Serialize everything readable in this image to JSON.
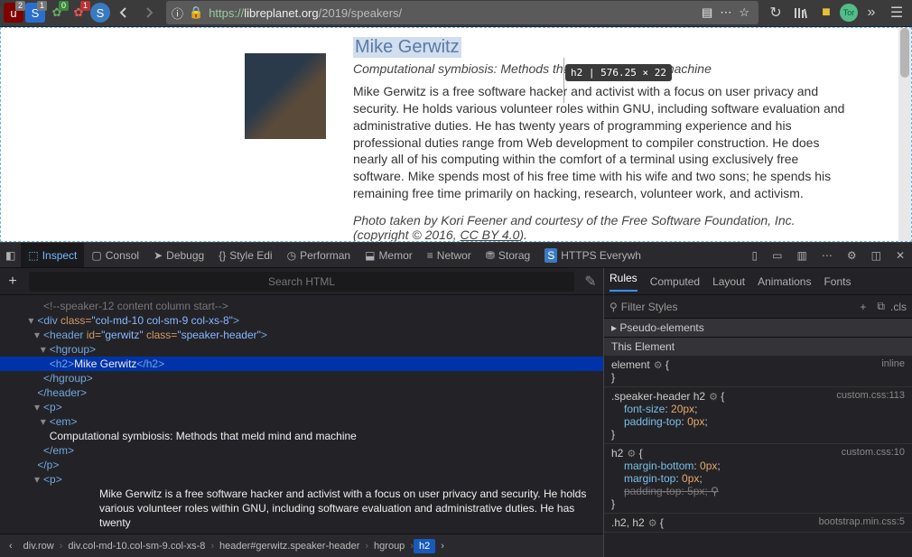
{
  "browser": {
    "ext1_badge": "2",
    "ext3_badge": "0",
    "ext4_badge": "1",
    "url_proto": "https://",
    "url_host": "libreplanet.org",
    "url_path": "/2019/speakers/"
  },
  "page": {
    "speaker_name": "Mike Gerwitz",
    "subtitle": "Computational symbiosis: Methods that meld mind and machine",
    "bio": "Mike Gerwitz is a free software hacker and activist with a focus on user privacy and security. He holds various volunteer roles within GNU, including software evaluation and administrative duties. He has twenty years of programming experience and his professional duties range from Web development to compiler construction. He does nearly all of his computing within the comfort of a terminal using exclusively free software. Mike spends most of his free time with his wife and two sons; he spends his remaining free time primarily on hacking, research, volunteer work, and activism.",
    "credit_pre": "Photo taken by Kori Feener and courtesy of the Free Software Foundation, Inc. (copyright © 2016, ",
    "credit_link": "CC BY 4.0",
    "credit_post": ").",
    "tooltip": "h2 | 576.25 × 22"
  },
  "devtools": {
    "tabs": [
      "Inspect",
      "Consol",
      "Debugg",
      "Style Edi",
      "Performan",
      "Memor",
      "Networ",
      "Storag",
      "HTTPS Everywh"
    ],
    "search_placeholder": "Search HTML",
    "tree": {
      "l0": "<!--speaker-12 content column start-->",
      "l1_open": "<div ",
      "l1_attr1": "class=",
      "l1_val1": "\"col-md-10 col-sm-9 col-xs-8\"",
      "l1_close": ">",
      "l2_open": "<header ",
      "l2_a1": "id=",
      "l2_v1": "\"gerwitz\"",
      "l2_a2": " class=",
      "l2_v2": "\"speaker-header\"",
      "l2_close": ">",
      "l3": "<hgroup>",
      "l4_open": "<h2>",
      "l4_text": "Mike Gerwitz",
      "l4_close": "</h2>",
      "l5": "</hgroup>",
      "l6": "</header>",
      "l7": "<p>",
      "l8": "<em>",
      "l9": "Computational symbiosis: Methods that meld mind and machine",
      "l10": "</em>",
      "l11": "</p>",
      "l12": "<p>",
      "l13": "Mike Gerwitz is a free software hacker and activist with a focus on user privacy and security. He holds various volunteer roles within GNU, including software evaluation and administrative duties. He has twenty"
    },
    "side_tabs": [
      "Rules",
      "Computed",
      "Layout",
      "Animations",
      "Fonts"
    ],
    "filter_label": "Filter Styles",
    "cls_label": ".cls",
    "pseudo_label": "Pseudo-elements",
    "this_element": "This Element",
    "rules": [
      {
        "selector": "element",
        "source": "inline",
        "props": []
      },
      {
        "selector": ".speaker-header h2",
        "source": "custom.css:113",
        "props": [
          {
            "n": "font-size",
            "v": "20px",
            "struck": false
          },
          {
            "n": "padding-top",
            "v": "0px",
            "struck": false
          }
        ]
      },
      {
        "selector": "h2",
        "source": "custom.css:10",
        "props": [
          {
            "n": "margin-bottom",
            "v": "0px",
            "struck": false
          },
          {
            "n": "margin-top",
            "v": "0px",
            "struck": false
          },
          {
            "n": "padding-top",
            "v": "5px",
            "struck": true
          }
        ]
      },
      {
        "selector": ".h2, h2",
        "source": "bootstrap.min.css:5",
        "props": []
      }
    ],
    "breadcrumb": [
      "div.row",
      "div.col-md-10.col-sm-9.col-xs-8",
      "header#gerwitz.speaker-header",
      "hgroup",
      "h2"
    ]
  }
}
